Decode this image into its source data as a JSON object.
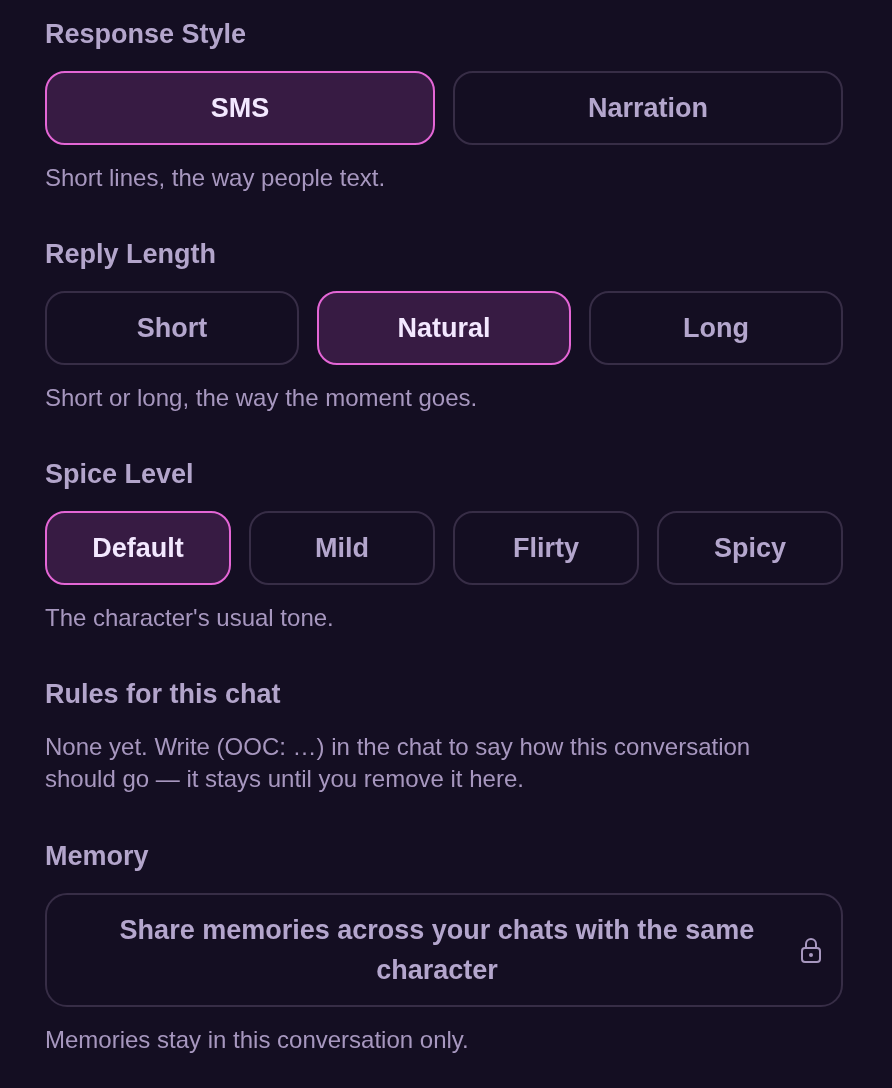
{
  "sections": [
    {
      "kind": "options",
      "title": "Response Style",
      "options": [
        {
          "label": "SMS",
          "selected": true
        },
        {
          "label": "Narration",
          "selected": false
        }
      ],
      "hint": "Short lines, the way people text."
    },
    {
      "kind": "options",
      "title": "Reply Length",
      "options": [
        {
          "label": "Short",
          "selected": false
        },
        {
          "label": "Natural",
          "selected": true
        },
        {
          "label": "Long",
          "selected": false
        }
      ],
      "hint": "Short or long, the way the moment goes."
    },
    {
      "kind": "options",
      "title": "Spice Level",
      "options": [
        {
          "label": "Default",
          "selected": true
        },
        {
          "label": "Mild",
          "selected": false
        },
        {
          "label": "Flirty",
          "selected": false
        },
        {
          "label": "Spicy",
          "selected": false
        }
      ],
      "hint": "The character's usual tone."
    },
    {
      "kind": "text",
      "title": "Rules for this chat",
      "body": "None yet. Write (OOC: …) in the chat to say how this conversation should go — it stays until you remove it here."
    },
    {
      "kind": "toggle",
      "title": "Memory",
      "toggle": {
        "label": "Share memories across your chats with the same character",
        "locked": true
      },
      "hint": "Memories stay in this conversation only."
    }
  ]
}
